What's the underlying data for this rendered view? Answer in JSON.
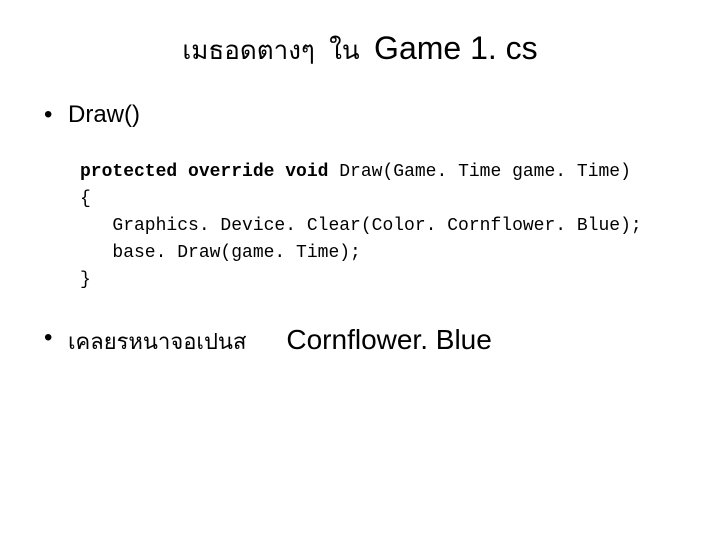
{
  "title": {
    "thai1": "เมธอดตางๆ",
    "thai2": "ใน",
    "filename": "Game 1. cs"
  },
  "bullet1": "Draw()",
  "code": {
    "line1a": "protected override void",
    "line1b": " Draw(Game. Time game. Time)",
    "line2": "{",
    "line3": "   Graphics. Device. Clear(Color. Cornflower. Blue);",
    "line4": "   base. Draw(game. Time);",
    "line5": "}"
  },
  "bullet2": {
    "label": "เคลยรหนาจอเปนส",
    "value": "Cornflower. Blue"
  }
}
